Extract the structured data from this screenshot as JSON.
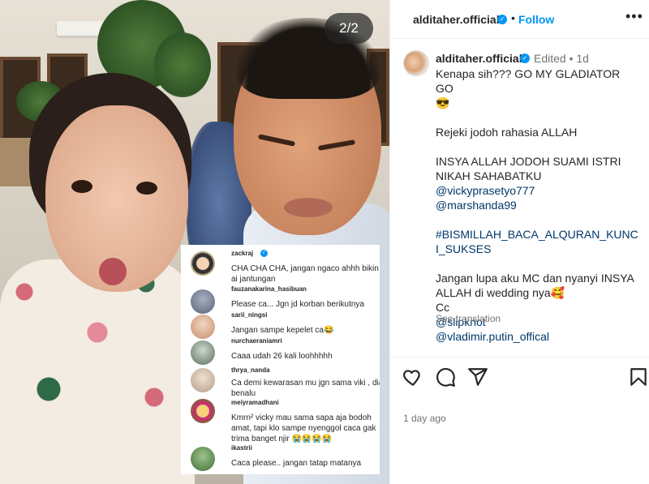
{
  "media": {
    "counter": "2/2",
    "comments": [
      {
        "user": "zackraj",
        "text": "CHA CHA CHA, jangan ngaco ahhh bikin ai jantungan",
        "verified": true
      },
      {
        "user": "fauzanakarina_hasibuan",
        "text": "Please ca... Jgn jd korban berikutnya"
      },
      {
        "user": "sarii_ningsi",
        "text": "Jangan sampe kepelet ca😂"
      },
      {
        "user": "nurchaeraniamri",
        "text": "Caaa udah 26 kali loohhhhh"
      },
      {
        "user": "thrya_nanda",
        "text": "Ca demi kewarasan mu jgn sama viki , dia benalu"
      },
      {
        "user": "meiyramadhani",
        "text": "Kmrn² vicky mau sama sapa aja bodoh amat, tapi klo sampe nyenggol caca gak trima banget njir 😭😭😭😭"
      },
      {
        "user": "ikastrii",
        "text": "Caca please.. jangan tatap matanya"
      }
    ]
  },
  "header": {
    "username": "alditaher.official",
    "dot": "•",
    "follow": "Follow",
    "more": "•••"
  },
  "caption": {
    "username": "alditaher.official",
    "edited": "Edited • 1d",
    "line1": "Kenapa sih??? GO MY GLADIATOR GO",
    "emoji1": "😎",
    "line2": "Rejeki jodoh rahasia ALLAH",
    "line3": "INSYA ALLAH JODOH SUAMI ISTRI NIKAH SAHABATKU",
    "mention1": "@vickyprasetyo777",
    "mention2": "@marshanda99",
    "hashtag": "#BISMILLAH_BACA_ALQURAN_KUNCI_SUKSES",
    "line4": "Jangan lupa aku MC dan nyanyi INSYA ALLAH di wedding nya🥰",
    "cc": "Cc",
    "mention3": "@slipknot",
    "mention4": "@vladimir.putin_offical",
    "see_translation": "See translation"
  },
  "footer": {
    "date": "1 day ago"
  },
  "colors": {
    "accent": "#0095f6",
    "link": "#00376b",
    "muted": "#737373"
  },
  "icons": [
    "heart-icon",
    "comment-icon",
    "share-icon",
    "bookmark-icon",
    "verified-icon",
    "more-icon"
  ]
}
